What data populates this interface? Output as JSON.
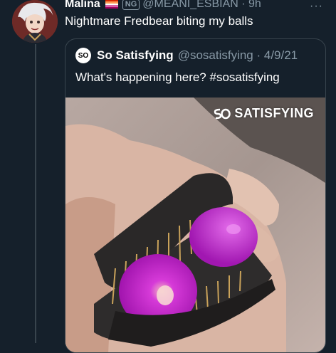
{
  "tweet": {
    "display_name": "Malina",
    "badge": "NG",
    "handle_time": "@MEANI_ESBIAN · 9h",
    "more_icon": "more-dots-icon",
    "text": "Nightmare Fredbear biting my balls"
  },
  "quote": {
    "logo_text": "SO",
    "name": "So Satisfying",
    "handle_date": "@sosatisfying · 4/9/21",
    "text": "What's happening here? #sosatisfying",
    "watermark": "SATISFYING"
  },
  "colors": {
    "background": "#15202b",
    "secondary_text": "#8899a6",
    "border": "#38444d",
    "accent_magenta": "#d21fd6"
  }
}
